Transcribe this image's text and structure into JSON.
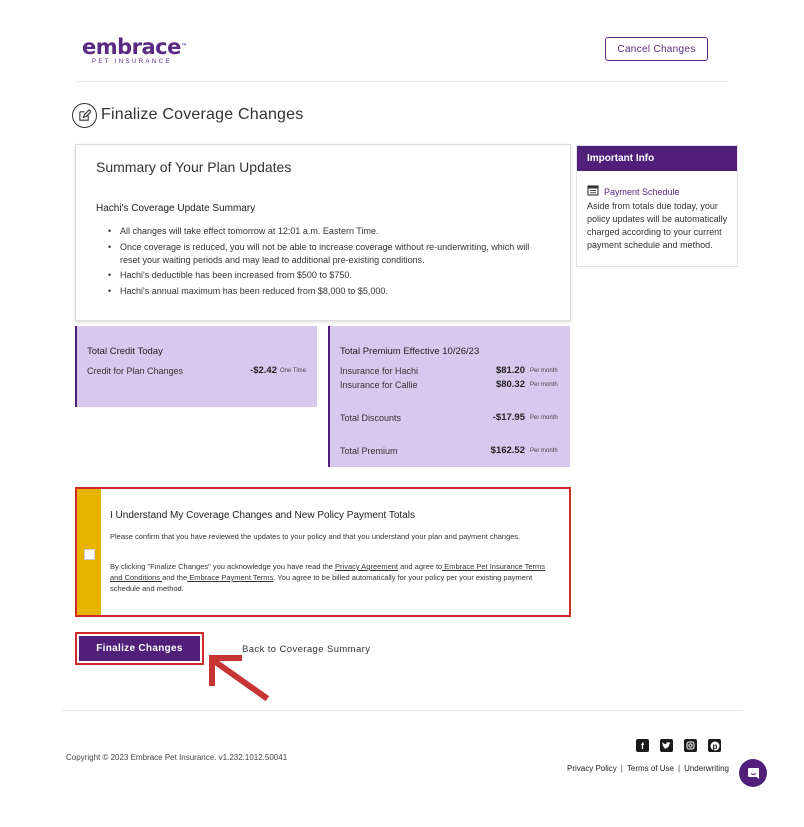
{
  "header": {
    "logo_main": "embrace",
    "logo_tm": "™",
    "logo_sub": "PET INSURANCE",
    "cancel_label": "Cancel Changes"
  },
  "page_title": "Finalize Coverage Changes",
  "summary": {
    "heading": "Summary of Your Plan Updates",
    "pet_summary_title": "Hachi's Coverage Update Summary",
    "bullets": [
      "All changes will take effect tomorrow at 12:01 a.m. Eastern Time.",
      "Once coverage is reduced, you will not be able to increase coverage without re-underwriting, which will reset your waiting periods and may lead to additional pre-existing conditions.",
      "Hachi's deductible has been increased from $500 to $750.",
      "Hachi's annual maximum has been reduced from $8,000 to $5,000."
    ]
  },
  "important_info": {
    "header": "Important Info",
    "link_label": "Payment Schedule",
    "text": "Aside from totals due today, your policy updates will be automatically charged according to your current payment schedule and method."
  },
  "credit": {
    "title": "Total Credit Today",
    "label": "Credit for Plan Changes",
    "amount": "-$2.42",
    "period": "One Time"
  },
  "premium": {
    "title": "Total Premium Effective 10/26/23",
    "rows": [
      {
        "label": "Insurance for Hachi",
        "amount": "$81.20",
        "period": "Per month"
      },
      {
        "label": "Insurance for Callie",
        "amount": "$80.32",
        "period": "Per month"
      },
      {
        "label": "Total Discounts",
        "amount": "-$17.95",
        "period": "Per month"
      },
      {
        "label": "Total Premium",
        "amount": "$162.52",
        "period": "Per month"
      }
    ]
  },
  "confirm": {
    "title": "I Understand My Coverage Changes and New Policy Payment Totals",
    "p1": "Please confirm that you have reviewed the updates to your policy and that you understand your plan and payment changes.",
    "p2_a": "By clicking \"Finalize Changes\" you acknowledge you have read the ",
    "privacy_link": "Privacy Agreement",
    "p2_b": " and agree to",
    "terms_link": " Embrace Pet Insurance Terms and Conditions ",
    "p2_c": "and the",
    "payment_link": " Embrace Payment Terms",
    "p2_d": ". You agree to be billed automatically for your policy per your existing payment schedule and method."
  },
  "actions": {
    "finalize_label": "Finalize Changes",
    "back_label": "Back to Coverage Summary"
  },
  "footer": {
    "copyright": "Copyright © 2023   Embrace Pet Insurance. v1.232.1012.50041",
    "links": [
      "Privacy Policy",
      "Terms of Use",
      "Underwriting"
    ],
    "social": [
      "facebook-icon",
      "twitter-icon",
      "instagram-icon",
      "pinterest-icon"
    ]
  },
  "colors": {
    "brand_purple": "#4f1f7a",
    "panel_lavender": "#d7c9ee",
    "highlight_red": "#cf2a2a",
    "stripe_yellow": "#e8b400"
  }
}
